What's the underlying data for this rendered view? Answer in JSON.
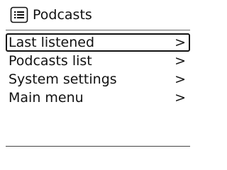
{
  "header": {
    "icon": "list-icon",
    "title": "Podcasts"
  },
  "menu": {
    "items": [
      {
        "label": "Last listened",
        "arrow": ">",
        "selected": true
      },
      {
        "label": "Podcasts list",
        "arrow": ">",
        "selected": false
      },
      {
        "label": "System settings",
        "arrow": ">",
        "selected": false
      },
      {
        "label": "Main menu",
        "arrow": ">",
        "selected": false
      }
    ]
  }
}
